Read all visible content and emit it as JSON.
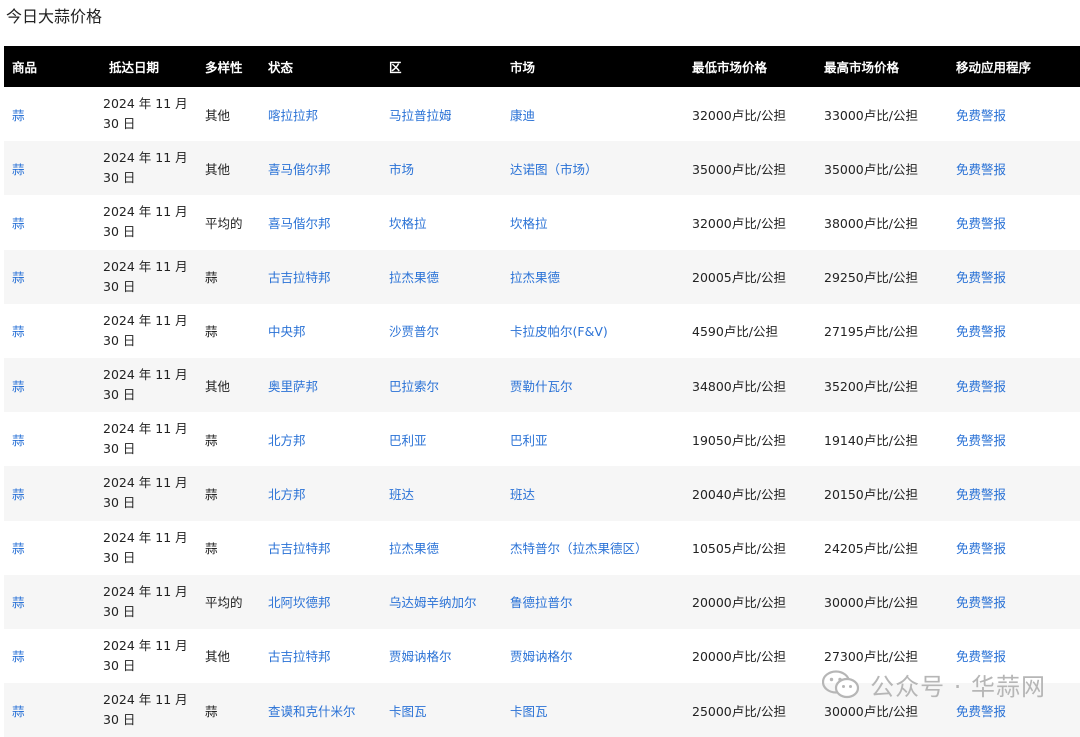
{
  "page_title": "今日大蒜价格",
  "table": {
    "headers": [
      "商品",
      "抵达日期",
      "多样性",
      "状态",
      "区",
      "市场",
      "最低市场价格",
      "最高市场价格",
      "移动应用程序"
    ],
    "rows": [
      {
        "commodity": "蒜",
        "date": "2024 年 11 月 30 日",
        "variety": "其他",
        "state": "喀拉拉邦",
        "district": "马拉普拉姆",
        "market": "康迪",
        "min": "32000卢比/公担",
        "max": "33000卢比/公担",
        "app": "免费警报"
      },
      {
        "commodity": "蒜",
        "date": "2024 年 11 月 30 日",
        "variety": "其他",
        "state": "喜马偕尔邦",
        "district": "市场",
        "market": "达诺图（市场）",
        "min": "35000卢比/公担",
        "max": "35000卢比/公担",
        "app": "免费警报"
      },
      {
        "commodity": "蒜",
        "date": "2024 年 11 月 30 日",
        "variety": "平均的",
        "state": "喜马偕尔邦",
        "district": "坎格拉",
        "market": "坎格拉",
        "min": "32000卢比/公担",
        "max": "38000卢比/公担",
        "app": "免费警报"
      },
      {
        "commodity": "蒜",
        "date": "2024 年 11 月 30 日",
        "variety": "蒜",
        "state": "古吉拉特邦",
        "district": "拉杰果德",
        "market": "拉杰果德",
        "min": "20005卢比/公担",
        "max": "29250卢比/公担",
        "app": "免费警报"
      },
      {
        "commodity": "蒜",
        "date": "2024 年 11 月 30 日",
        "variety": "蒜",
        "state": "中央邦",
        "district": "沙贾普尔",
        "market": "卡拉皮帕尔(F&V)",
        "min": "4590卢比/公担",
        "max": "27195卢比/公担",
        "app": "免费警报"
      },
      {
        "commodity": "蒜",
        "date": "2024 年 11 月 30 日",
        "variety": "其他",
        "state": "奥里萨邦",
        "district": "巴拉索尔",
        "market": "贾勒什瓦尔",
        "min": "34800卢比/公担",
        "max": "35200卢比/公担",
        "app": "免费警报"
      },
      {
        "commodity": "蒜",
        "date": "2024 年 11 月 30 日",
        "variety": "蒜",
        "state": "北方邦",
        "district": "巴利亚",
        "market": "巴利亚",
        "min": "19050卢比/公担",
        "max": "19140卢比/公担",
        "app": "免费警报"
      },
      {
        "commodity": "蒜",
        "date": "2024 年 11 月 30 日",
        "variety": "蒜",
        "state": "北方邦",
        "district": "班达",
        "market": "班达",
        "min": "20040卢比/公担",
        "max": "20150卢比/公担",
        "app": "免费警报"
      },
      {
        "commodity": "蒜",
        "date": "2024 年 11 月 30 日",
        "variety": "蒜",
        "state": "古吉拉特邦",
        "district": "拉杰果德",
        "market": "杰特普尔（拉杰果德区）",
        "min": "10505卢比/公担",
        "max": "24205卢比/公担",
        "app": "免费警报"
      },
      {
        "commodity": "蒜",
        "date": "2024 年 11 月 30 日",
        "variety": "平均的",
        "state": "北阿坎德邦",
        "district": "乌达姆辛纳加尔",
        "market": "鲁德拉普尔",
        "min": "20000卢比/公担",
        "max": "30000卢比/公担",
        "app": "免费警报"
      },
      {
        "commodity": "蒜",
        "date": "2024 年 11 月 30 日",
        "variety": "其他",
        "state": "古吉拉特邦",
        "district": "贾姆讷格尔",
        "market": "贾姆讷格尔",
        "min": "20000卢比/公担",
        "max": "27300卢比/公担",
        "app": "免费警报"
      },
      {
        "commodity": "蒜",
        "date": "2024 年 11 月 30 日",
        "variety": "蒜",
        "state": "查谟和克什米尔",
        "district": "卡图瓦",
        "market": "卡图瓦",
        "min": "25000卢比/公担",
        "max": "30000卢比/公担",
        "app": "免费警报"
      }
    ]
  },
  "watermark": {
    "text": "公众号 · 华蒜网",
    "icon": "wechat-icon"
  },
  "colors": {
    "link": "#2a72d6",
    "header_bg": "#000000",
    "row_alt": "#f6f6f6"
  }
}
